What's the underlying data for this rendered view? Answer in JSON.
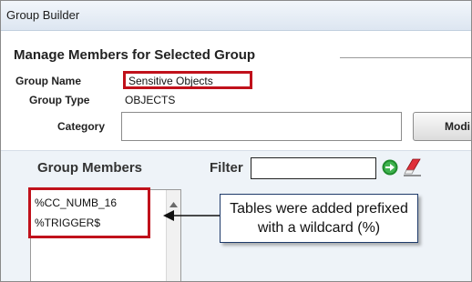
{
  "window": {
    "title": "Group Builder"
  },
  "section": {
    "heading": "Manage Members for Selected Group"
  },
  "fields": {
    "group_name_label": "Group Name",
    "group_name_value": "Sensitive Objects",
    "group_type_label": "Group Type",
    "group_type_value": "OBJECTS",
    "category_label": "Category",
    "category_value": ""
  },
  "buttons": {
    "modify_label": "Modi"
  },
  "members": {
    "heading": "Group Members",
    "filter_label": "Filter",
    "filter_value": "",
    "items": [
      "%CC_NUMB_16",
      "%TRIGGER$"
    ]
  },
  "callout": {
    "line1": "Tables were added prefixed",
    "line2": "with a wildcard (%)"
  },
  "icons": {
    "go": "go-arrow-icon",
    "clear": "eraser-icon",
    "scroll_up": "scroll-up-icon"
  },
  "colors": {
    "highlight": "#c0111b",
    "go_green": "#1f8a2c",
    "eraser_red": "#e0303a",
    "callout_border": "#1e3a6a"
  }
}
